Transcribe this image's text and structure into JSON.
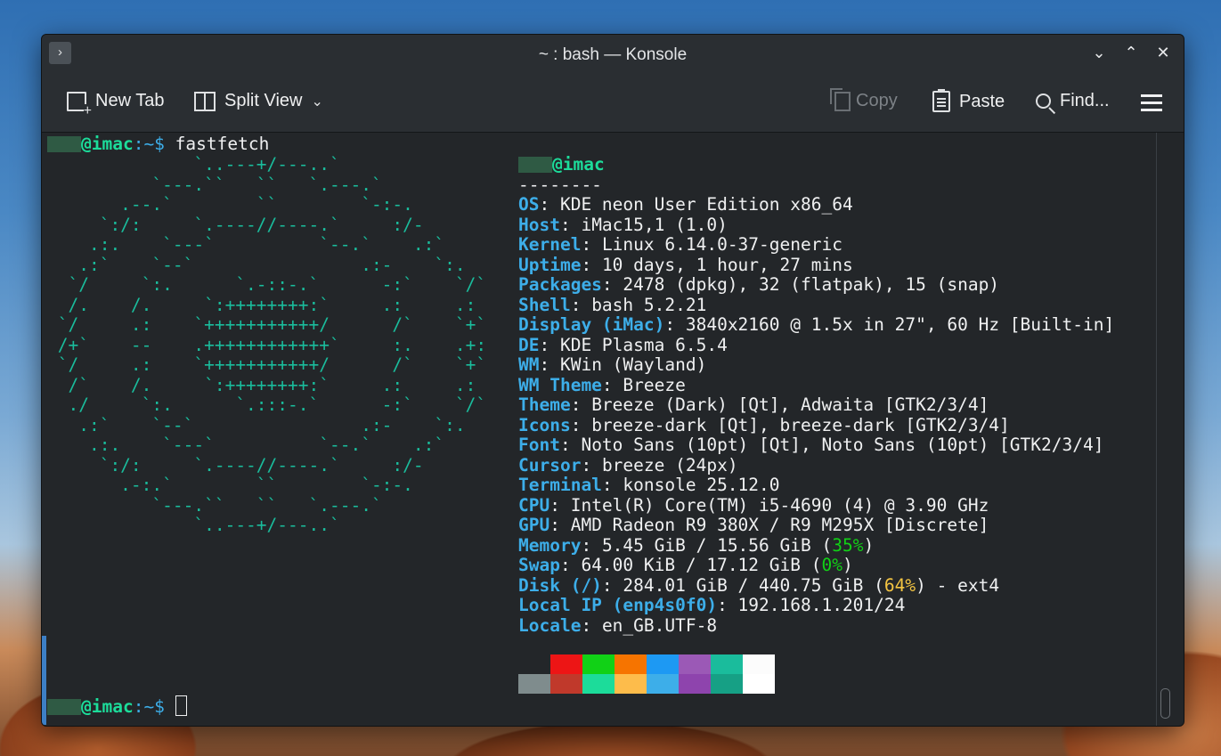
{
  "window": {
    "title": "~ : bash — Konsole"
  },
  "titlebar": {
    "menu_glyph": "›",
    "minimize_glyph": "⌄",
    "maximize_glyph": "⌃",
    "close_glyph": "✕"
  },
  "toolbar": {
    "new_tab": "New Tab",
    "split_view": "Split View",
    "copy": "Copy",
    "paste": "Paste",
    "find": "Find...",
    "dropdown_glyph": "⌄"
  },
  "terminal": {
    "prompt_host": "@imac",
    "prompt_tail": ":~$ ",
    "command": "fastfetch",
    "ascii_art": [
      "              `..---+/---..`",
      "          `---.``   ``   `.---.`",
      "       .--.`        ``        `-:-.",
      "     `:/:     `.----//----.`     :/-",
      "    .:.    `---`          `--.`    .:`",
      "   .:`    `--`                .:-    `:.",
      "  `/     `:.      `.-::-.`      -:`    `/`",
      "  /.    /.     `:++++++++:`     .:     .:",
      " `/     .:    `+++++++++++/      /`    `+`",
      " /+`    --    .++++++++++++`     :.    .+:",
      " `/     .:    `+++++++++++/      /`    `+`",
      "  /`    /.     `:++++++++:`     .:     .:",
      "  ./     `:.      `.:::-.`      -:`    `/`",
      "   .:`    `--`                .:-    `:.",
      "    .:.    `---`          `--.`    .:`",
      "     `:/:     `.----//----.`     :/-",
      "       .-:.`        ``        `-:-.",
      "          `---.``   ``   `.---.`",
      "              `..---+/---..`"
    ],
    "info_host": "@imac",
    "separator": "--------",
    "info": [
      {
        "key": "OS",
        "value": "KDE neon User Edition x86_64"
      },
      {
        "key": "Host",
        "value": "iMac15,1 (1.0)"
      },
      {
        "key": "Kernel",
        "value": "Linux 6.14.0-37-generic"
      },
      {
        "key": "Uptime",
        "value": "10 days, 1 hour, 27 mins"
      },
      {
        "key": "Packages",
        "value": "2478 (dpkg), 32 (flatpak), 15 (snap)"
      },
      {
        "key": "Shell",
        "value": "bash 5.2.21"
      },
      {
        "key": "Display (iMac)",
        "value": "3840x2160 @ 1.5x in 27\", 60 Hz [Built-in]"
      },
      {
        "key": "DE",
        "value": "KDE Plasma 6.5.4"
      },
      {
        "key": "WM",
        "value": "KWin (Wayland)"
      },
      {
        "key": "WM Theme",
        "value": "Breeze"
      },
      {
        "key": "Theme",
        "value": "Breeze (Dark) [Qt], Adwaita [GTK2/3/4]"
      },
      {
        "key": "Icons",
        "value": "breeze-dark [Qt], breeze-dark [GTK2/3/4]"
      },
      {
        "key": "Font",
        "value": "Noto Sans (10pt) [Qt], Noto Sans (10pt) [GTK2/3/4]"
      },
      {
        "key": "Cursor",
        "value": "breeze (24px)"
      },
      {
        "key": "Terminal",
        "value": "konsole 25.12.0"
      },
      {
        "key": "CPU",
        "value": "Intel(R) Core(TM) i5-4690 (4) @ 3.90 GHz"
      },
      {
        "key": "GPU",
        "value": "AMD Radeon R9 380X / R9 M295X [Discrete]"
      }
    ],
    "memory": {
      "key": "Memory",
      "pre": "5.45 GiB / 15.56 GiB (",
      "pct": "35%",
      "post": ")"
    },
    "swap": {
      "key": "Swap",
      "pre": "64.00 KiB / 17.12 GiB (",
      "pct": "0%",
      "post": ")"
    },
    "disk": {
      "key": "Disk (/)",
      "pre": "284.01 GiB / 440.75 GiB (",
      "pct": "64%",
      "post": ") - ext4"
    },
    "local_ip": {
      "key": "Local IP (enp4s0f0)",
      "value": "192.168.1.201/24"
    },
    "locale": {
      "key": "Locale",
      "value": "en_GB.UTF-8"
    },
    "palette_top": [
      "#232629",
      "#ed1515",
      "#11d116",
      "#f67400",
      "#1d99f3",
      "#9b59b6",
      "#1abc9c",
      "#fcfcfc"
    ],
    "palette_bottom": [
      "#7f8c8d",
      "#c0392b",
      "#1cdc9a",
      "#fdbc4b",
      "#3daee9",
      "#8e44ad",
      "#16a085",
      "#ffffff"
    ]
  },
  "colors": {
    "terminal_bg": "#232629",
    "chrome_bg": "#2a2e32",
    "prompt_green": "#1cdc9a",
    "key_blue": "#3daee9",
    "ascii_teal": "#1abc9c"
  }
}
